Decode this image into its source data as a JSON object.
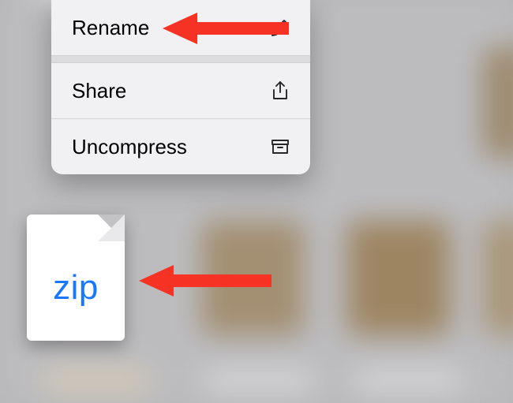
{
  "menu": {
    "rename": "Rename",
    "share": "Share",
    "uncompress": "Uncompress"
  },
  "file": {
    "type_label": "zip"
  },
  "colors": {
    "accent": "#1978ff",
    "arrow": "#f53224"
  }
}
